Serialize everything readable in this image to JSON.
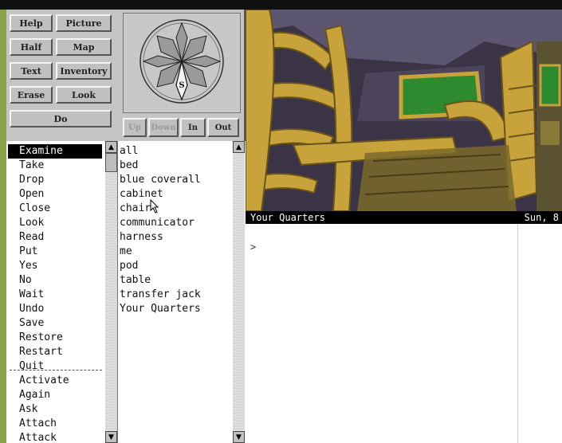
{
  "buttons": {
    "help": "Help",
    "picture": "Picture",
    "half": "Half",
    "map": "Map",
    "text": "Text",
    "inventory": "Inventory",
    "erase": "Erase",
    "look": "Look",
    "do": "Do"
  },
  "compass": {
    "south_label": "S"
  },
  "directions": {
    "up": "Up",
    "down": "Down",
    "in": "In",
    "out": "Out"
  },
  "verbs": [
    "Examine",
    "Take",
    "Drop",
    "Open",
    "Close",
    "Look",
    "Read",
    "Put",
    "Yes",
    "No",
    "Wait",
    "Undo",
    "Save",
    "Restore",
    "Restart",
    "Quit",
    "Activate",
    "Again",
    "Ask",
    "Attach",
    "Attack"
  ],
  "verbs_selected_index": 0,
  "nouns": [
    "all",
    "bed",
    "blue coverall",
    "cabinet",
    "chair",
    "communicator",
    "harness",
    "me",
    "pod",
    "table",
    "transfer jack",
    "Your Quarters"
  ],
  "status": {
    "location": "Your Quarters",
    "date": "Sun, 8"
  },
  "output": {
    "prompt": ">"
  },
  "scrollbar_arrows": {
    "up": "▲",
    "down": "▼"
  },
  "colors": {
    "accent": "#000000",
    "panel": "#c4c4c4",
    "scene_floor": "#c8a23a",
    "scene_screen": "#2e8a2e"
  }
}
